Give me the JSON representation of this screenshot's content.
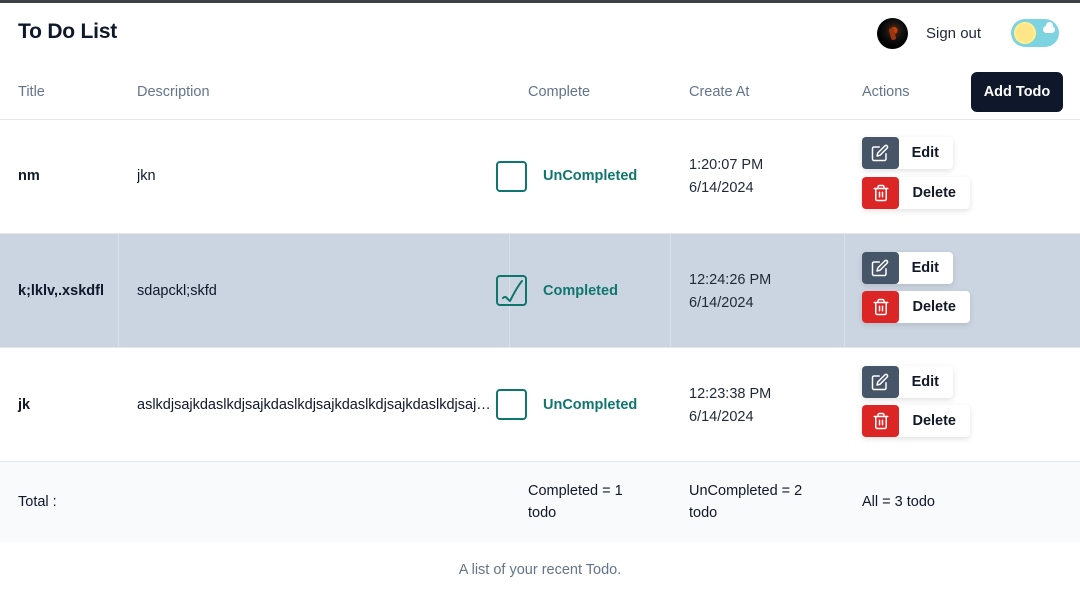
{
  "app": {
    "title": "To Do List",
    "sign_out": "Sign out"
  },
  "colors": {
    "accent": "#0f766e",
    "header_btn": "#0f172a",
    "edit": "#475569",
    "delete": "#dc2626",
    "selected_row": "#cbd5e1"
  },
  "table": {
    "headers": {
      "title": "Title",
      "description": "Description",
      "complete": "Complete",
      "created": "Create At",
      "actions": "Actions"
    },
    "add_button": "Add Todo",
    "edit_label": "Edit",
    "delete_label": "Delete",
    "rows": [
      {
        "title": "nm",
        "description": "jkn",
        "complete": false,
        "status": "UnCompleted",
        "time": "1:20:07 PM",
        "date": "6/14/2024"
      },
      {
        "title": "k;lklv,.xskdfl",
        "description": "sdapckl;skfd",
        "complete": true,
        "status": "Completed",
        "time": "12:24:26 PM",
        "date": "6/14/2024"
      },
      {
        "title": "jk",
        "description": "aslkdjsajkdaslkdjsajkdaslkdjsajkdaslkdjsajkdaslkdjsajkdaslkdjsajkdaslkd",
        "complete": false,
        "status": "UnCompleted",
        "time": "12:23:38 PM",
        "date": "6/14/2024"
      }
    ],
    "footer": {
      "total": "Total :",
      "completed_line1": "Completed = 1",
      "completed_line2": "todo",
      "uncompleted_line1": "UnCompleted = 2",
      "uncompleted_line2": "todo",
      "all": "All = 3 todo"
    },
    "caption": "A list of your recent Todo."
  }
}
